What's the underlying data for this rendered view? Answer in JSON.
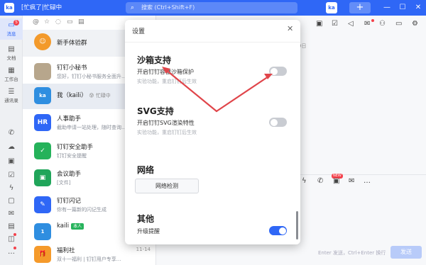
{
  "titlebar": {
    "logo_text": "ka",
    "status": "[忙疯了|忙碌中",
    "search_placeholder": "搜索 (Ctrl+Shift+F)",
    "avatar_text": "ka",
    "plus": "+",
    "minimize": "—",
    "maximize": "☐",
    "close": "✕"
  },
  "leftnav": {
    "messages": {
      "icon": "chat-bubble-icon",
      "label": "消息",
      "badge": "5"
    },
    "docs": {
      "icon": "document-icon",
      "label": "文档"
    },
    "workbench": {
      "icon": "grid-icon",
      "label": "工作台"
    },
    "contacts": {
      "icon": "contacts-icon",
      "label": "通讯录"
    }
  },
  "conversations": [
    {
      "name": "新手体验群",
      "preview": "",
      "time": "",
      "avatar_color": "#f39a2b",
      "avatar_text": "☺"
    },
    {
      "name": "钉钉小秘书",
      "preview": "您好，钉钉小秘书服务全面升...",
      "time": "",
      "avatar_color": "#b7a68c",
      "avatar_text": ""
    },
    {
      "name": "我（kaili）",
      "status": "忙碌中",
      "preview": "",
      "time": "",
      "avatar_color": "#2f8ee0",
      "avatar_text": "ka"
    },
    {
      "name": "人事助手",
      "preview": "截助申请一站处理，随时查询...",
      "time": "",
      "avatar_color": "#2f67f6",
      "avatar_text": "HR"
    },
    {
      "name": "钉钉安全助手",
      "preview": "钉钉安全提醒",
      "time": "",
      "avatar_color": "#25b25a",
      "avatar_text": "✓"
    },
    {
      "name": "会议助手",
      "preview": "[文件]",
      "time": "",
      "avatar_color": "#20a55a",
      "avatar_text": "▣"
    },
    {
      "name": "钉钉闪记",
      "preview": "你有一篇新的闪记生成",
      "time": "",
      "avatar_color": "#2f67f6",
      "avatar_text": "✎"
    },
    {
      "name": "kaili",
      "tag": "本人",
      "preview": "",
      "time": "",
      "avatar_color": "#2f8ee0",
      "avatar_text": "1"
    },
    {
      "name": "福利社",
      "preview": "双十一福利 | 钉钉用户专享...",
      "time": "11-14",
      "avatar_color": "#f59a2b",
      "avatar_text": "🎁"
    }
  ],
  "chat": {
    "date_partial": "9日",
    "send_hint": "Enter 发送，Ctrl+Enter 换行",
    "send_label": "发送",
    "new_badge": "NEW"
  },
  "dialog": {
    "title": "设置",
    "close": "✕",
    "sandbox": {
      "title": "沙箱支持",
      "label": "开启钉钉容器沙箱保护",
      "note": "实验功能，重启钉钉后生效",
      "enabled": false
    },
    "svg": {
      "title": "SVG支持",
      "label": "开启钉钉SVG渲染特性",
      "note": "实验功能，重启钉钉后生效",
      "enabled": false
    },
    "network": {
      "title": "网络",
      "button": "网络检测"
    },
    "other": {
      "title": "其他",
      "label": "升级提醒",
      "enabled": true
    }
  },
  "colors": {
    "accent": "#2f67f6",
    "annotation_arrow": "#e0454a"
  }
}
